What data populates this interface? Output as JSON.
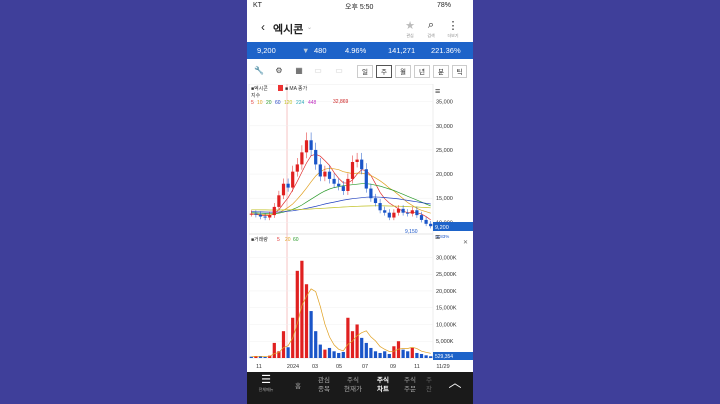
{
  "status": {
    "carrier": "KT",
    "time": "오후 5:50",
    "battery": "78%"
  },
  "header": {
    "title": "엑시콘",
    "icons": [
      {
        "name": "star-icon",
        "glyph": "★",
        "label": "관심"
      },
      {
        "name": "search-icon",
        "glyph": "⌕",
        "label": "검색"
      },
      {
        "name": "more-icon",
        "glyph": "⋮",
        "label": "더보기"
      }
    ]
  },
  "quote": {
    "price": "9,200",
    "direction": "▼",
    "change": "480",
    "change_pct": "4.96%",
    "volume": "141,271",
    "turnover_pct": "221.36%"
  },
  "toolbar": {
    "icons": [
      "wrench-icon",
      "gear-icon",
      "grid-icon",
      "compare-icon",
      "expand-icon"
    ],
    "periods": [
      "일",
      "주",
      "월",
      "년",
      "분",
      "틱"
    ],
    "selected_period": "주"
  },
  "chart_data": {
    "type": "candlestick",
    "price_panel": {
      "stock_label": "■엑시콘",
      "ma_label": "■ MA 종가",
      "index_label": "지수",
      "ma_periods": [
        "5",
        "10",
        "20",
        "60",
        "120",
        "224",
        "448"
      ],
      "ma_colors": [
        "#e03030",
        "#e0a020",
        "#2a9a2a",
        "#2040c0",
        "#c0c020",
        "#2aa8b8",
        "#c030c0"
      ],
      "y_ticks": [
        "35,000",
        "30,000",
        "25,000",
        "20,000",
        "15,000",
        "10,000"
      ],
      "ylim": [
        8000,
        37000
      ],
      "high_label": "32,869",
      "low_label": "9,150",
      "last_price": "9,200",
      "last_change": "-5.83%",
      "closes": [
        11800,
        11600,
        11200,
        11000,
        11500,
        13200,
        15600,
        18000,
        17200,
        20500,
        22000,
        24500,
        27000,
        25000,
        22000,
        19500,
        20500,
        19000,
        18000,
        17500,
        16500,
        19000,
        22500,
        23000,
        21000,
        17000,
        15000,
        14000,
        12500,
        12000,
        11000,
        12000,
        12800,
        12000,
        11800,
        12500,
        11500,
        10500,
        9700,
        9200
      ],
      "ma": [
        [
          11700,
          11650,
          11500,
          11400,
          11420,
          11800,
          12600,
          13900,
          15100,
          16700,
          18500,
          20400,
          22300,
          23800,
          24100,
          23700,
          22800,
          21800,
          20300,
          19100,
          18200,
          18100,
          18800,
          20000,
          20900,
          20700,
          19700,
          18000,
          16200,
          14900,
          14000,
          13400,
          12800,
          12300,
          12000,
          12100,
          12000,
          11700,
          11200,
          10500
        ],
        [
          11800,
          11750,
          11650,
          11600,
          11550,
          11650,
          12000,
          12500,
          13100,
          13800,
          14800,
          15900,
          17100,
          18400,
          19600,
          20500,
          21000,
          21200,
          21100,
          20900,
          20500,
          20300,
          20100,
          20200,
          20200,
          20000,
          19700,
          19200,
          18600,
          17900,
          17100,
          16500,
          15700,
          14900,
          14100,
          13500,
          12900,
          12500,
          12200,
          11900
        ],
        [
          12000,
          11950,
          11900,
          11850,
          11800,
          11800,
          11900,
          12100,
          12400,
          12700,
          13100,
          13600,
          14200,
          14800,
          15400,
          16000,
          16500,
          16900,
          17200,
          17400,
          17600,
          17700,
          17800,
          17900,
          18000,
          18000,
          17900,
          17700,
          17500,
          17200,
          16900,
          16600,
          16200,
          15800,
          15400,
          15000,
          14600,
          14200,
          13800,
          13400
        ],
        [
          12200,
          12180,
          12160,
          12140,
          12120,
          12120,
          12140,
          12200,
          12300,
          12400,
          12550,
          12700,
          12900,
          13100,
          13300,
          13550,
          13800,
          14000,
          14200,
          14400,
          14600,
          14750,
          14900,
          15000,
          15100,
          15200,
          15250,
          15250,
          15200,
          15150,
          15050,
          14950,
          14850,
          14700,
          14550,
          14400,
          14250,
          14100,
          13950,
          13800
        ],
        [
          12600,
          12590,
          12580,
          12570,
          12560,
          12560,
          12560,
          12570,
          12590,
          12610,
          12640,
          12680,
          12720,
          12770,
          12820,
          12880,
          12940,
          13000,
          13060,
          13120,
          13180,
          13230,
          13280,
          13320,
          13360,
          13390,
          13410,
          13420,
          13420,
          13410,
          13390,
          13370,
          13340,
          13300,
          13260,
          13220,
          13170,
          13120,
          13070,
          13020
        ]
      ]
    },
    "volume_panel": {
      "label": "■거래량",
      "ma_periods": [
        "5",
        "20",
        "60"
      ],
      "ma_colors": [
        "#e03030",
        "#e0a020",
        "#2a9a2a"
      ],
      "y_ticks": [
        "30,000K",
        "25,000K",
        "20,000K",
        "15,000K",
        "10,000K",
        "5,000K"
      ],
      "ylim": [
        0,
        34000
      ],
      "last_volume": "529,354",
      "values": [
        400,
        600,
        500,
        300,
        700,
        4500,
        2000,
        8000,
        3200,
        12000,
        26000,
        29000,
        22000,
        14000,
        8000,
        4000,
        2500,
        3000,
        2000,
        1500,
        1800,
        12000,
        8000,
        10000,
        6000,
        4500,
        3000,
        2000,
        1500,
        2000,
        1200,
        3500,
        5000,
        2500,
        2000,
        3000,
        1500,
        1200,
        800,
        529
      ],
      "up": [
        false,
        true,
        false,
        false,
        true,
        true,
        true,
        true,
        false,
        true,
        true,
        true,
        true,
        false,
        false,
        false,
        true,
        false,
        false,
        false,
        false,
        true,
        true,
        true,
        false,
        false,
        false,
        false,
        false,
        false,
        false,
        true,
        true,
        false,
        false,
        true,
        false,
        false,
        false,
        false
      ]
    },
    "x_ticks": [
      "11",
      "2024",
      "03",
      "05",
      "07",
      "09",
      "11",
      "11/29"
    ]
  },
  "bottom_nav": {
    "menu_label": "전체메뉴",
    "items": [
      "홈",
      "관심\n종목",
      "주식\n현재가",
      "주식\n차트",
      "주식\n주문",
      "주\n잔"
    ],
    "active_index": 3
  }
}
